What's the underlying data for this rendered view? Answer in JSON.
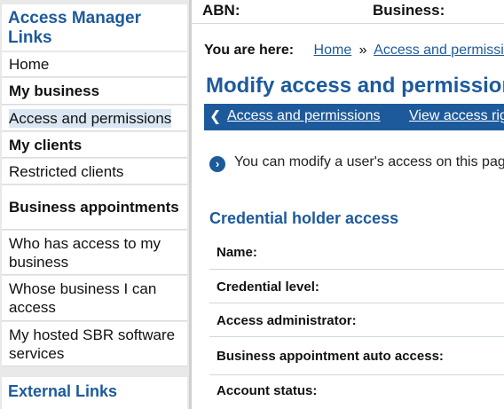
{
  "sidebar": {
    "heading": "Access Manager Links",
    "items": [
      {
        "label": "Home",
        "bold": false
      },
      {
        "label": "My business",
        "bold": true
      },
      {
        "label": "Access and permissions",
        "bold": false,
        "active": true
      },
      {
        "label": "My clients",
        "bold": true
      },
      {
        "label": "Restricted clients",
        "bold": false
      },
      {
        "label": "Business appointments",
        "bold": true
      },
      {
        "label": "Who has access to my business",
        "bold": false
      },
      {
        "label": "Whose business I can access",
        "bold": false
      },
      {
        "label": "My hosted SBR software services",
        "bold": false
      }
    ],
    "external_heading": "External Links"
  },
  "header": {
    "abn_label": "ABN:",
    "business_label": "Business:"
  },
  "breadcrumb": {
    "label": "You are here:",
    "items": [
      "Home",
      "Access and permissions"
    ],
    "separator": "»"
  },
  "page_title": "Modify access and permissions",
  "tabs": {
    "back_icon": "chevron-left-icon",
    "links": [
      "Access and permissions",
      "View access rights"
    ]
  },
  "info": {
    "icon": "chevron-right-circle-icon",
    "text": "You can modify a user's access on this page."
  },
  "section": {
    "title": "Credential holder access",
    "fields": [
      "Name:",
      "Credential level:",
      "Access administrator:",
      "Business appointment auto access:",
      "Account status:"
    ]
  },
  "colors": {
    "brand_blue": "#1d5a9c",
    "sidebar_bg": "#e9e9e9",
    "active_highlight": "#dbe6f3"
  }
}
